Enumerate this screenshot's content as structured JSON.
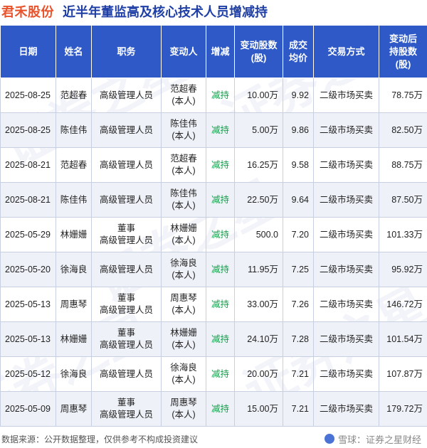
{
  "title": {
    "company": "君禾股份",
    "headline": "近半年董监高及核心技术人员增减持"
  },
  "watermark_text": "证券之星",
  "table": {
    "headers": [
      "日期",
      "姓名",
      "职务",
      "变动人",
      "增减",
      "变动股数\n(股)",
      "成交\n均价",
      "交易方式",
      "变动后\n持股数\n(股)"
    ],
    "rows": [
      [
        "2025-08-25",
        "范超春",
        "高级管理人员",
        "范超春\n(本人)",
        "减持",
        "10.00万",
        "9.92",
        "二级市场买卖",
        "78.75万"
      ],
      [
        "2025-08-25",
        "陈佳伟",
        "高级管理人员",
        "陈佳伟\n(本人)",
        "减持",
        "5.00万",
        "9.86",
        "二级市场买卖",
        "82.50万"
      ],
      [
        "2025-08-21",
        "范超春",
        "高级管理人员",
        "范超春\n(本人)",
        "减持",
        "16.25万",
        "9.58",
        "二级市场买卖",
        "88.75万"
      ],
      [
        "2025-08-21",
        "陈佳伟",
        "高级管理人员",
        "陈佳伟\n(本人)",
        "减持",
        "22.50万",
        "9.64",
        "二级市场买卖",
        "87.50万"
      ],
      [
        "2025-05-29",
        "林姗姗",
        "董事\n高级管理人员",
        "林姗姗\n(本人)",
        "减持",
        "500.0",
        "7.20",
        "二级市场买卖",
        "101.33万"
      ],
      [
        "2025-05-20",
        "徐海良",
        "高级管理人员",
        "徐海良\n(本人)",
        "减持",
        "11.95万",
        "7.25",
        "二级市场买卖",
        "95.92万"
      ],
      [
        "2025-05-13",
        "周惠琴",
        "董事\n高级管理人员",
        "周惠琴\n(本人)",
        "减持",
        "33.00万",
        "7.26",
        "二级市场买卖",
        "146.72万"
      ],
      [
        "2025-05-13",
        "林姗姗",
        "董事\n高级管理人员",
        "林姗姗\n(本人)",
        "减持",
        "24.10万",
        "7.28",
        "二级市场买卖",
        "101.54万"
      ],
      [
        "2025-05-12",
        "徐海良",
        "高级管理人员",
        "徐海良\n(本人)",
        "减持",
        "20.00万",
        "7.21",
        "二级市场买卖",
        "107.87万"
      ],
      [
        "2025-05-09",
        "周惠琴",
        "董事\n高级管理人员",
        "周惠琴\n(本人)",
        "减持",
        "15.00万",
        "7.21",
        "二级市场买卖",
        "179.72万"
      ]
    ]
  },
  "footer": {
    "source": "数据来源：公开数据整理，仅供参考不构成投资建议",
    "brand": "雪球：证券之星财经"
  },
  "colors": {
    "header_bg": "#2e59c7",
    "company": "#e8532b",
    "headline": "#1f3fa6",
    "decrease": "#12a04a"
  }
}
